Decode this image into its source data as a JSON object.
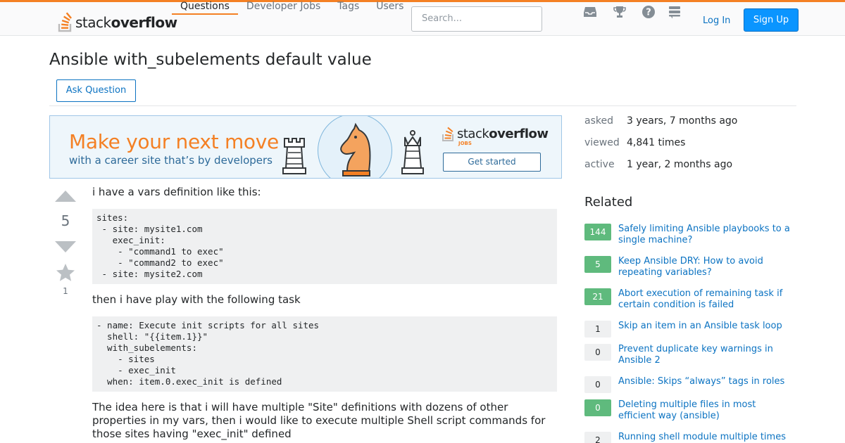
{
  "header": {
    "logo_text_light": "stack",
    "logo_text_bold": "overflow",
    "nav": [
      {
        "label": "Questions"
      },
      {
        "label": "Developer Jobs"
      },
      {
        "label": "Tags"
      },
      {
        "label": "Users"
      }
    ],
    "search_placeholder": "Search...",
    "icons": [
      "inbox-icon",
      "achievements-icon",
      "help-icon",
      "site-switcher-icon"
    ],
    "login_label": "Log In",
    "signup_label": "Sign Up"
  },
  "question": {
    "title": "Ansible with_subelements default value",
    "ask_button": "Ask Question",
    "votes": "5",
    "favorites": "1",
    "body": {
      "p1": "i have a vars definition like this:",
      "code1": "sites:\n - site: mysite1.com\n   exec_init:\n    - \"command1 to exec\"\n    - \"command2 to exec\"\n - site: mysite2.com",
      "p2": "then i have play with the following task",
      "code2": "- name: Execute init scripts for all sites\n  shell: \"{{item.1}}\"\n  with_subelements:\n    - sites\n    - exec_init\n  when: item.0.exec_init is defined",
      "p3_line1": "The idea here is that i will have multiple \"Site\" definitions with dozens of other",
      "p3_line2": "properties in my vars, then i would like to execute multiple Shell script commands for",
      "p3_line3": "those sites having \"exec_init\" defined"
    }
  },
  "ad": {
    "headline": "Make your next move",
    "subline": "with a career site that’s by developers",
    "brand_light": "stack",
    "brand_bold": "overflow",
    "brand_sub": "JOBS",
    "cta": "Get started"
  },
  "sidebar": {
    "meta": [
      {
        "label": "asked",
        "value": "3 years, 7 months ago"
      },
      {
        "label": "viewed",
        "value": "4,841 times"
      },
      {
        "label": "active",
        "value": "1 year, 2 months ago"
      }
    ],
    "related_title": "Related",
    "related": [
      {
        "count": "144",
        "accepted": true,
        "title_l1": "Safely limiting Ansible playbooks to a",
        "title_l2": "single machine?"
      },
      {
        "count": "5",
        "accepted": true,
        "title_l1": "Keep Ansible DRY: How to avoid",
        "title_l2": "repeating variables?"
      },
      {
        "count": "21",
        "accepted": true,
        "title_l1": "Abort execution of remaining task if",
        "title_l2": "certain condition is failed"
      },
      {
        "count": "1",
        "accepted": false,
        "title_l1": "Skip an item in an Ansible task loop",
        "title_l2": ""
      },
      {
        "count": "0",
        "accepted": false,
        "title_l1": "Prevent duplicate key warnings in",
        "title_l2": "Ansible 2"
      },
      {
        "count": "0",
        "accepted": false,
        "title_l1": "Ansible: Skips “always” tags in roles",
        "title_l2": ""
      },
      {
        "count": "0",
        "accepted": true,
        "title_l1": "Deleting multiple files in most",
        "title_l2": "efficient way (ansible)"
      },
      {
        "count": "2",
        "accepted": false,
        "title_l1": "Running shell module multiple times",
        "title_l2": ""
      }
    ]
  },
  "colors": {
    "brand_orange": "#f48024",
    "link_blue": "#0c73c2",
    "accepted_green": "#5fba7d",
    "signup_blue": "#0a95ff"
  }
}
